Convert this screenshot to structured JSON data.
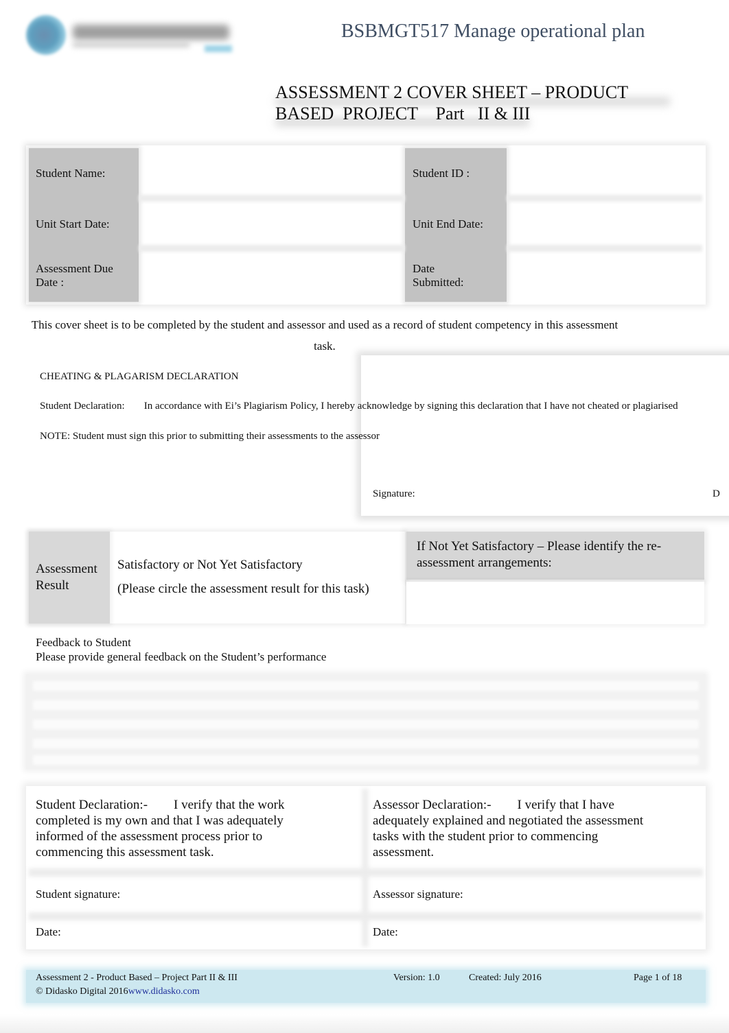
{
  "header": {
    "logo_name": "Everest Institute logo",
    "unit_title": "BSBMGT517 Manage operational plan"
  },
  "title": {
    "line1": "ASSESSMENT 2 COVER SHEET – PRODUCT",
    "line2": "BASED  PROJECT    Part   II & III"
  },
  "info_table": {
    "student_name_label": "Student Name:",
    "student_id_label": "Student ID :",
    "unit_start_label": "Unit Start Date:",
    "unit_end_label": "Unit End Date:",
    "due_date_label_1": "Assessment Due",
    "due_date_label_2": "Date :",
    "submitted_label_1": "Date",
    "submitted_label_2": "Submitted:",
    "student_name_value": "",
    "student_id_value": "",
    "unit_start_value": "",
    "unit_end_value": "",
    "due_date_value": "",
    "submitted_value": ""
  },
  "cover_note": "This cover sheet is to be completed by the student and assessor and used as a record of student competency in this assessment task.",
  "plagiarism": {
    "heading": "CHEATING & PLAGARISM DECLARATION",
    "declaration_label": "Student Declaration:",
    "declaration_text": "In accordance with Ei’s Plagiarism Policy, I hereby acknowledge by signing this declaration that I have not cheated or plagiarised",
    "note": "NOTE: Student must sign this prior to submitting their assessments to the assessor",
    "signature_label": "Signature:",
    "date_label_partial": "D"
  },
  "result": {
    "label_1": "Assessment",
    "label_2": "Result",
    "options_text": "Satisfactory or Not Yet Satisfactory",
    "instruction": "(Please circle the assessment result for this task)",
    "nys_heading": "If Not Yet Satisfactory – Please identify the re-assessment arrangements:",
    "nys_value": ""
  },
  "feedback": {
    "title": "Feedback to Student",
    "subtitle": "Please provide general feedback on the Student’s performance",
    "lines": [
      "",
      "",
      "",
      "",
      ""
    ]
  },
  "declarations": {
    "student_text": "Student Declaration:-        I verify that the work completed is my own and that I was adequately informed of the assessment process prior to commencing this assessment task.",
    "assessor_text": "Assessor Declaration:-        I verify that I have adequately explained and negotiated the assessment tasks with the student prior to commencing assessment.",
    "student_signature_label": "Student signature:",
    "assessor_signature_label": "Assessor signature:",
    "student_date_label": "Date:",
    "assessor_date_label": "Date:"
  },
  "footer": {
    "doc_name": "Assessment 2 - Product Based – Project Part II & III",
    "copyright": "© Didasko Digital 2016",
    "link": "www.didasko.com",
    "version": "Version: 1.0",
    "created": "Created: July 2016",
    "page": "Page 1 of 18"
  }
}
